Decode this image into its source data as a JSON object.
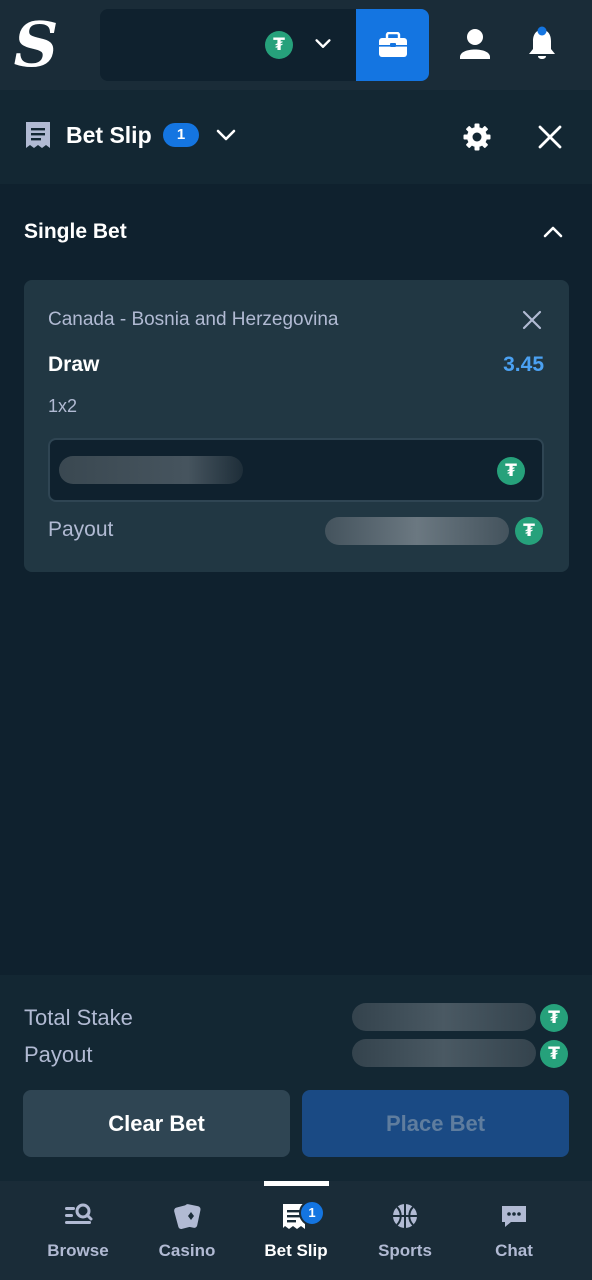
{
  "header": {
    "logo_letter": "S",
    "currency_icon": "tether-coin-icon",
    "coin_glyph": "₮"
  },
  "bet_slip": {
    "title": "Bet Slip",
    "count": "1"
  },
  "section": {
    "title": "Single Bet"
  },
  "bet": {
    "event": "Canada - Bosnia and Herzegovina",
    "outcome": "Draw",
    "odds": "3.45",
    "market": "1x2",
    "payout_label": "Payout"
  },
  "summary": {
    "total_stake_label": "Total Stake",
    "payout_label": "Payout",
    "clear_label": "Clear Bet",
    "place_label": "Place Bet"
  },
  "nav": {
    "items": [
      {
        "label": "Browse",
        "icon": "browse-icon"
      },
      {
        "label": "Casino",
        "icon": "casino-cards-icon"
      },
      {
        "label": "Bet Slip",
        "icon": "bet-slip-icon"
      },
      {
        "label": "Sports",
        "icon": "basketball-icon"
      },
      {
        "label": "Chat",
        "icon": "chat-icon"
      }
    ],
    "bet_slip_badge": "1"
  },
  "colors": {
    "background": "#0f212e",
    "accent_blue": "#1475e1",
    "odds_blue": "#4ba1f2",
    "tether_green": "#26a17b"
  }
}
